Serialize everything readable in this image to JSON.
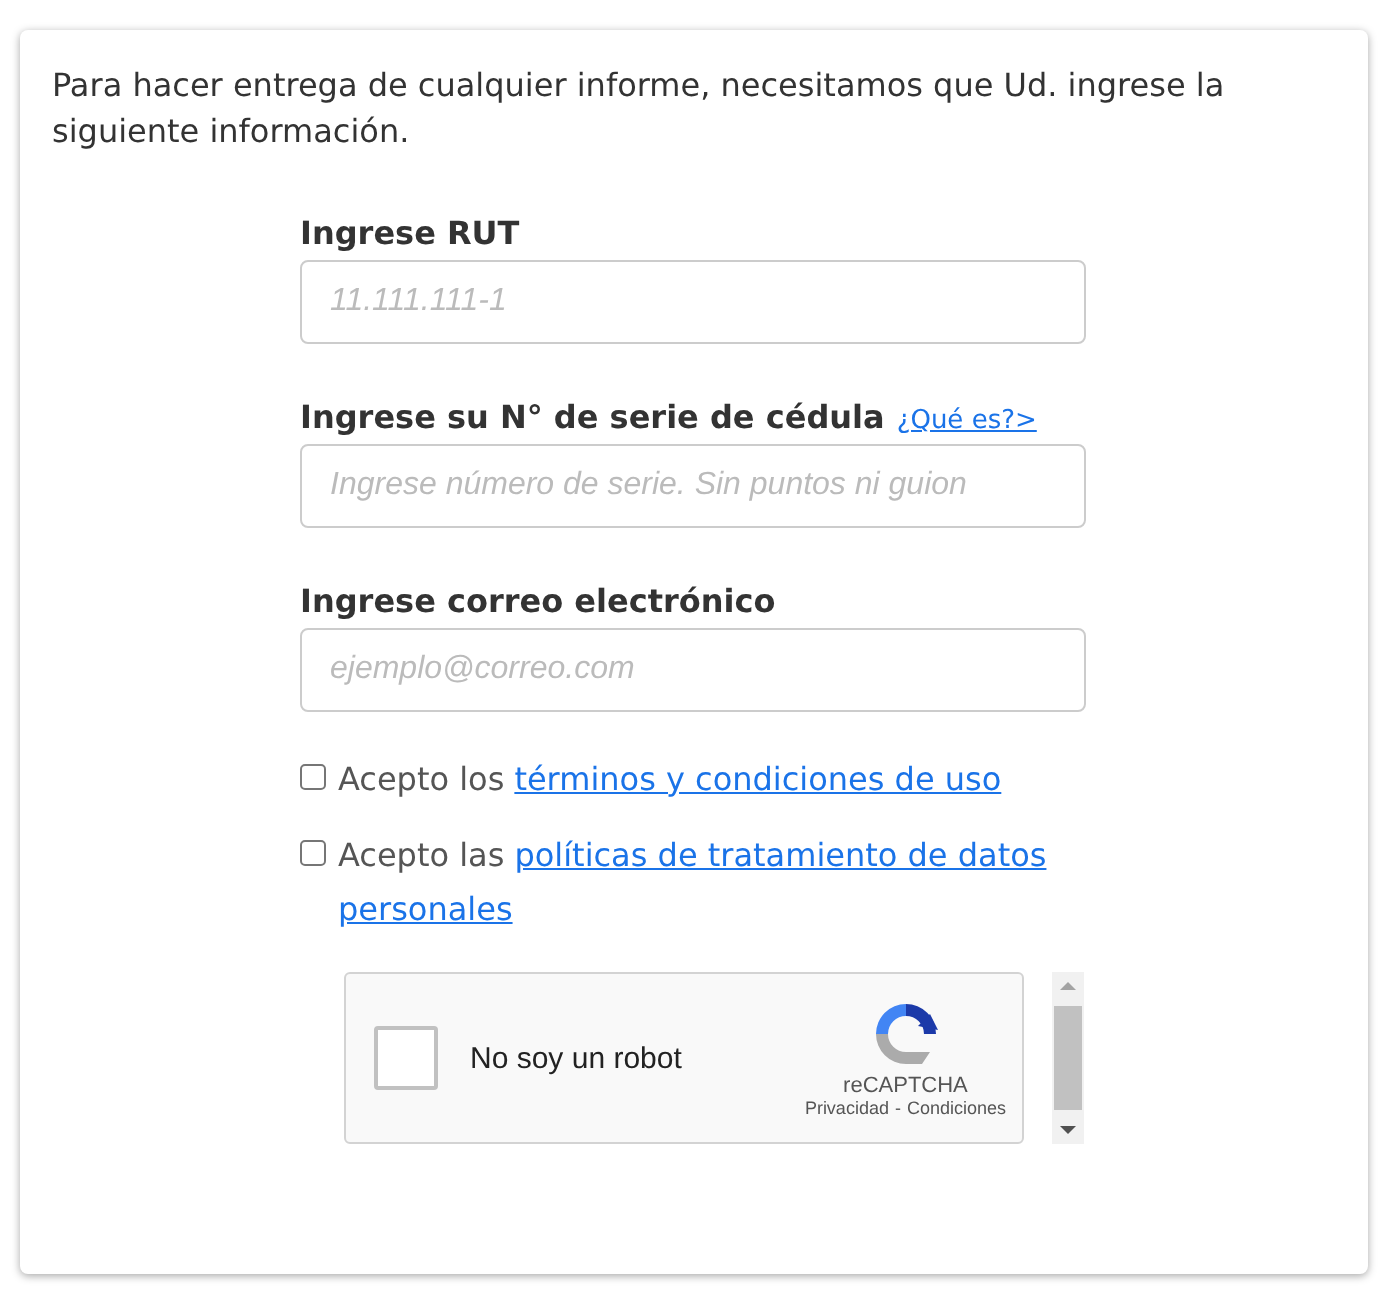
{
  "intro": "Para hacer entrega de cualquier informe, necesitamos que Ud. ingrese la siguiente información.",
  "fields": [
    {
      "label": "Ingrese RUT",
      "placeholder": "11.111.111-1"
    },
    {
      "label": "Ingrese su N° de serie de cédula",
      "link": "¿Qué es?>",
      "placeholder": "Ingrese número de serie. Sin puntos ni guion"
    },
    {
      "label": "Ingrese correo electrónico",
      "placeholder": "ejemplo@correo.com"
    }
  ],
  "agreements": [
    {
      "text": "Acepto los",
      "link_lines": [
        "términos y condiciones de uso"
      ],
      "checked": false
    },
    {
      "text": "Acepto las",
      "link_lines": [
        "políticas de tratamiento de datos",
        "personales"
      ],
      "checked": false
    }
  ],
  "captcha": {
    "label": "No soy un robot",
    "checked": false,
    "brand": "reCAPTCHA",
    "privacy": "Privacidad",
    "separator": "-",
    "terms": "Condiciones"
  }
}
